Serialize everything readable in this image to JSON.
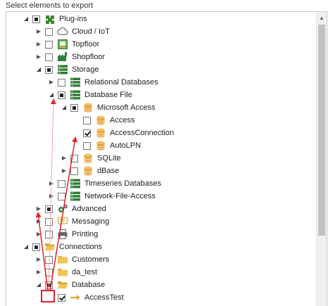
{
  "header": {
    "title": "Select elements to export"
  },
  "tree": [
    {
      "id": "plugins",
      "label": "Plug-ins",
      "expander": "open",
      "check": "partial",
      "icon": "plugin-icon"
    },
    {
      "id": "cloud-iot",
      "label": "Cloud / IoT",
      "expander": "closed",
      "check": "unchecked",
      "icon": "cloud-icon"
    },
    {
      "id": "topfloor",
      "label": "Topfloor",
      "expander": "closed",
      "check": "unchecked",
      "icon": "topfloor-icon"
    },
    {
      "id": "shopfloor",
      "label": "Shopfloor",
      "expander": "closed",
      "check": "unchecked",
      "icon": "shopfloor-icon"
    },
    {
      "id": "storage",
      "label": "Storage",
      "expander": "open",
      "check": "partial",
      "icon": "storage-icon"
    },
    {
      "id": "relational-databases",
      "label": "Relational Databases",
      "expander": "closed",
      "check": "unchecked",
      "icon": "storage-icon"
    },
    {
      "id": "database-file",
      "label": "Database File",
      "expander": "open",
      "check": "partial",
      "icon": "storage-icon"
    },
    {
      "id": "microsoft-access",
      "label": "Microsoft Access",
      "expander": "open",
      "check": "partial",
      "icon": "database-icon"
    },
    {
      "id": "access",
      "label": "Access",
      "expander": "none",
      "check": "unchecked",
      "icon": "database-icon"
    },
    {
      "id": "access-connection",
      "label": "AccessConnection",
      "expander": "none",
      "check": "checked",
      "icon": "database-icon"
    },
    {
      "id": "autolpn",
      "label": "AutoLPN",
      "expander": "none",
      "check": "unchecked",
      "icon": "database-icon"
    },
    {
      "id": "sqlite",
      "label": "SQLite",
      "expander": "closed",
      "check": "unchecked",
      "icon": "database-icon"
    },
    {
      "id": "dbase",
      "label": "dBase",
      "expander": "closed",
      "check": "unchecked",
      "icon": "database-icon"
    },
    {
      "id": "timeseries-databases",
      "label": "Timeseries Databases",
      "expander": "closed",
      "check": "unchecked",
      "icon": "storage-icon"
    },
    {
      "id": "network-file-access",
      "label": "Network-File-Access",
      "expander": "closed",
      "check": "unchecked",
      "icon": "storage-icon"
    },
    {
      "id": "advanced",
      "label": "Advanced",
      "expander": "closed",
      "check": "partial",
      "icon": "gears-icon"
    },
    {
      "id": "messaging",
      "label": "Messaging",
      "expander": "closed",
      "check": "unchecked",
      "icon": "message-icon"
    },
    {
      "id": "printing",
      "label": "Printing",
      "expander": "closed",
      "check": "unchecked",
      "icon": "printer-icon"
    },
    {
      "id": "connections",
      "label": "Connections",
      "expander": "open",
      "check": "partial",
      "icon": "folder-open-icon"
    },
    {
      "id": "customers",
      "label": "Customers",
      "expander": "closed",
      "check": "unchecked",
      "icon": "folder-icon"
    },
    {
      "id": "da-test",
      "label": "da_test",
      "expander": "closed",
      "check": "unchecked",
      "icon": "folder-icon"
    },
    {
      "id": "database-folder",
      "label": "Database",
      "expander": "open",
      "check": "partial",
      "icon": "folder-open-icon"
    },
    {
      "id": "access-test",
      "label": "AccessTest",
      "expander": "none",
      "check": "checked",
      "icon": "connection-arrow-icon"
    }
  ],
  "colors": {
    "annotation": "#e0202a",
    "storage_green": "#2e7d32",
    "database_gold": "#e8a33c",
    "folder_yellow": "#f2c552"
  }
}
